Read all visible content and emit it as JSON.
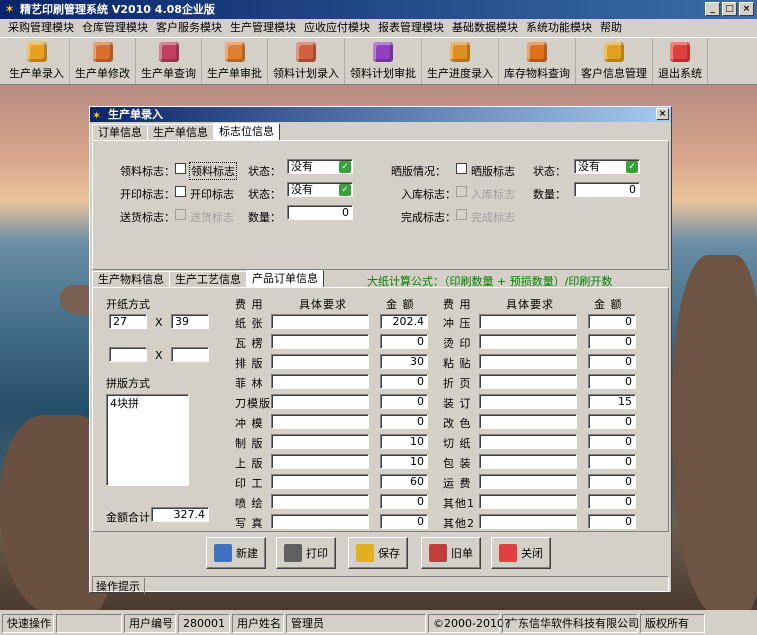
{
  "app": {
    "title": "精艺印刷管理系统  V2010  4.08企业版",
    "window_buttons": [
      "_",
      "□",
      "×"
    ]
  },
  "menu": [
    "采购管理模块",
    "仓库管理模块",
    "客户服务模块",
    "生产管理模块",
    "应收应付模块",
    "报表管理模块",
    "基础数据模块",
    "系统功能模块",
    "帮助"
  ],
  "toolbar": [
    {
      "label": "生产单录入",
      "icon": "box-icon",
      "color": "#e8a020"
    },
    {
      "label": "生产单修改",
      "icon": "pencil-box-icon",
      "color": "#d87030"
    },
    {
      "label": "生产单查询",
      "icon": "search-box-icon",
      "color": "#c04060"
    },
    {
      "label": "生产单审批",
      "icon": "approve-icon",
      "color": "#e08030"
    },
    {
      "label": "领料计划录入",
      "icon": "materials-icon",
      "color": "#d06040"
    },
    {
      "label": "领料计划审批",
      "icon": "materials-approve-icon",
      "color": "#9040c0"
    },
    {
      "label": "生产进度录入",
      "icon": "progress-icon",
      "color": "#e09020"
    },
    {
      "label": "库存物料查询",
      "icon": "inventory-icon",
      "color": "#e07020"
    },
    {
      "label": "客户信息管理",
      "icon": "customer-icon",
      "color": "#e0a020"
    },
    {
      "label": "退出系统",
      "icon": "exit-icon",
      "color": "#e04040"
    }
  ],
  "dialog": {
    "title": "生产单录入",
    "close": "×",
    "top_tabs": [
      "订单信息",
      "生产单信息",
      "标志位信息"
    ],
    "flags": {
      "row1": {
        "lbl1": "领料标志：",
        "chk1": "领料标志",
        "state_lbl": "状态：",
        "state_val": "没有",
        "lbl2": "晒版情况：",
        "chk2": "晒版标志",
        "state_lbl2": "状态：",
        "state_val2": "没有"
      },
      "row2": {
        "lbl1": "开印标志：",
        "chk1": "开印标志",
        "state_lbl": "状态：",
        "state_val": "没有",
        "lbl2": "入库标志：",
        "chk2": "入库标志",
        "qty_lbl": "数量：",
        "qty_val": "0"
      },
      "row3": {
        "lbl1": "送货标志：",
        "chk1": "送货标志",
        "qty_lbl": "数量：",
        "qty_val": "0",
        "lbl2": "完成标志：",
        "chk2": "完成标志"
      }
    },
    "bottom_tabs": [
      "生产物料信息",
      "生产工艺信息",
      "产品订单信息"
    ],
    "formula": "大纸计算公式：（印刷数量 + 预损数量）/印刷开数",
    "order": {
      "open_method_lbl": "开纸方式",
      "w1": "27",
      "x1": "X",
      "h1": "39",
      "w2": "",
      "x2": "X",
      "h2": "",
      "layout_lbl": "拼版方式",
      "layout_val": "4块拼",
      "total_lbl": "金额合计",
      "total_val": "327.4"
    },
    "headers": {
      "fee": "费 用",
      "req": "具体要求",
      "amt": "金 额"
    },
    "fees_left": [
      {
        "name": "纸 张",
        "req": "",
        "amt": "202.4"
      },
      {
        "name": "瓦 楞",
        "req": "",
        "amt": "0"
      },
      {
        "name": "排 版",
        "req": "",
        "amt": "30"
      },
      {
        "name": "菲 林",
        "req": "",
        "amt": "0"
      },
      {
        "name": "刀模版",
        "req": "",
        "amt": "0"
      },
      {
        "name": "冲 模",
        "req": "",
        "amt": "0"
      },
      {
        "name": "制 版",
        "req": "",
        "amt": "10"
      },
      {
        "name": "上 版",
        "req": "",
        "amt": "10"
      },
      {
        "name": "印 工",
        "req": "",
        "amt": "60"
      },
      {
        "name": "喷 绘",
        "req": "",
        "amt": "0"
      },
      {
        "name": "写 真",
        "req": "",
        "amt": "0"
      }
    ],
    "fees_right": [
      {
        "name": "冲 压",
        "req": "",
        "amt": "0"
      },
      {
        "name": "烫 印",
        "req": "",
        "amt": "0"
      },
      {
        "name": "粘 贴",
        "req": "",
        "amt": "0"
      },
      {
        "name": "折 页",
        "req": "",
        "amt": "0"
      },
      {
        "name": "装 订",
        "req": "",
        "amt": "15"
      },
      {
        "name": "改 色",
        "req": "",
        "amt": "0"
      },
      {
        "name": "切 纸",
        "req": "",
        "amt": "0"
      },
      {
        "name": "包 装",
        "req": "",
        "amt": "0"
      },
      {
        "name": "运 费",
        "req": "",
        "amt": "0"
      },
      {
        "name": "其他1",
        "req": "",
        "amt": "0"
      },
      {
        "name": "其他2",
        "req": "",
        "amt": "0"
      }
    ],
    "buttons": [
      {
        "label": "新建",
        "icon": "new-doc-icon",
        "color": "#4070c0"
      },
      {
        "label": "打印",
        "icon": "printer-icon",
        "color": "#606060"
      },
      {
        "label": "保存",
        "icon": "save-icon",
        "color": "#e0b020"
      },
      {
        "label": "旧单",
        "icon": "old-doc-icon",
        "color": "#c04040"
      },
      {
        "label": "关闭",
        "icon": "close-circle-icon",
        "color": "#e04040"
      }
    ],
    "tip": "操作提示"
  },
  "status": {
    "quick": "快速操作",
    "user_id_lbl": "用户编号",
    "user_id": "280001",
    "user_name_lbl": "用户姓名",
    "user_name": "管理员",
    "copyright": "©2000-2010?",
    "company": "广东信华软件科技有限公司",
    "rights": "版权所有"
  }
}
